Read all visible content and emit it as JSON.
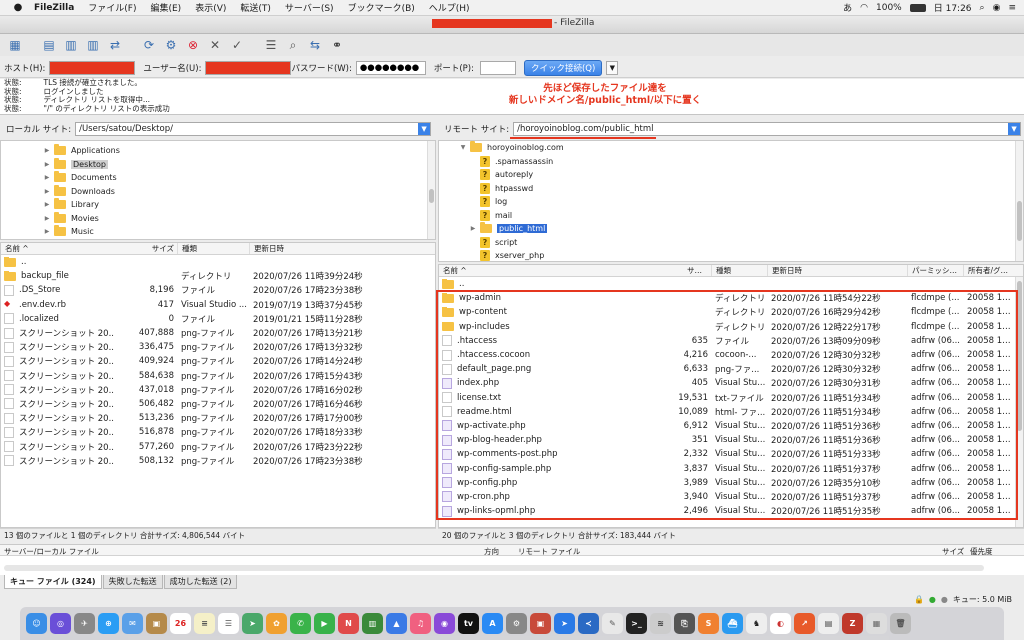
{
  "menubar": {
    "app": "FileZilla",
    "items": [
      "ファイル(F)",
      "編集(E)",
      "表示(V)",
      "転送(T)",
      "サーバー(S)",
      "ブックマーク(B)",
      "ヘルプ(H)"
    ],
    "ime": "あ",
    "battery": "100%",
    "clock": "日 17:26"
  },
  "window": {
    "title": "- FileZilla"
  },
  "quickconnect": {
    "host_label": "ホスト(H):",
    "user_label": "ユーザー名(U):",
    "pass_label": "パスワード(W):",
    "pass_value": "●●●●●●●●",
    "port_label": "ポート(P):",
    "button": "クイック接続(Q)"
  },
  "log": [
    {
      "k": "状態:",
      "v": "TLS 接続が確立されました。"
    },
    {
      "k": "状態:",
      "v": "ログインしました"
    },
    {
      "k": "状態:",
      "v": "ディレクトリ リストを取得中..."
    },
    {
      "k": "状態:",
      "v": "\"/\" のディレクトリ リストの表示成功"
    }
  ],
  "annotation": {
    "line1": "先ほど保存したファイル達を",
    "line2": "新しいドメイン名/public_html/以下に置く"
  },
  "local": {
    "label": "ローカル サイト:",
    "path": "/Users/satou/Desktop/",
    "tree": [
      {
        "name": "Applications",
        "sel": false
      },
      {
        "name": "Desktop",
        "sel": true
      },
      {
        "name": "Documents",
        "sel": false
      },
      {
        "name": "Downloads",
        "sel": false
      },
      {
        "name": "Library",
        "sel": false
      },
      {
        "name": "Movies",
        "sel": false
      },
      {
        "name": "Music",
        "sel": false
      }
    ],
    "headers": {
      "name": "名前",
      "size": "サイズ",
      "type": "種類",
      "date": "更新日時"
    },
    "files": [
      {
        "name": "..",
        "size": "",
        "type": "",
        "date": "",
        "icon": "folder"
      },
      {
        "name": "backup_file",
        "size": "",
        "type": "ディレクトリ",
        "date": "2020/07/26 11時39分24秒",
        "icon": "folder"
      },
      {
        "name": ".DS_Store",
        "size": "8,196",
        "type": "ファイル",
        "date": "2020/07/26 17時23分38秒",
        "icon": "file"
      },
      {
        "name": ".env.dev.rb",
        "size": "417",
        "type": "Visual Studio ...",
        "date": "2019/07/19 13時37分45秒",
        "icon": "rb"
      },
      {
        "name": ".localized",
        "size": "0",
        "type": "ファイル",
        "date": "2019/01/21 15時11分28秒",
        "icon": "file"
      },
      {
        "name": "スクリーンショット 20..",
        "size": "407,888",
        "type": "png-ファイル",
        "date": "2020/07/26 17時13分21秒",
        "icon": "file"
      },
      {
        "name": "スクリーンショット 20..",
        "size": "336,475",
        "type": "png-ファイル",
        "date": "2020/07/26 17時13分32秒",
        "icon": "file"
      },
      {
        "name": "スクリーンショット 20..",
        "size": "409,924",
        "type": "png-ファイル",
        "date": "2020/07/26 17時14分24秒",
        "icon": "file"
      },
      {
        "name": "スクリーンショット 20..",
        "size": "584,638",
        "type": "png-ファイル",
        "date": "2020/07/26 17時15分43秒",
        "icon": "file"
      },
      {
        "name": "スクリーンショット 20..",
        "size": "437,018",
        "type": "png-ファイル",
        "date": "2020/07/26 17時16分02秒",
        "icon": "file"
      },
      {
        "name": "スクリーンショット 20..",
        "size": "506,482",
        "type": "png-ファイル",
        "date": "2020/07/26 17時16分46秒",
        "icon": "file"
      },
      {
        "name": "スクリーンショット 20..",
        "size": "513,236",
        "type": "png-ファイル",
        "date": "2020/07/26 17時17分00秒",
        "icon": "file"
      },
      {
        "name": "スクリーンショット 20..",
        "size": "516,878",
        "type": "png-ファイル",
        "date": "2020/07/26 17時18分33秒",
        "icon": "file"
      },
      {
        "name": "スクリーンショット 20..",
        "size": "577,260",
        "type": "png-ファイル",
        "date": "2020/07/26 17時23分22秒",
        "icon": "file"
      },
      {
        "name": "スクリーンショット 20..",
        "size": "508,132",
        "type": "png-ファイル",
        "date": "2020/07/26 17時23分38秒",
        "icon": "file"
      }
    ],
    "status": "13 個のファイルと 1 個のディレクトリ 合計サイズ: 4,806,544 バイト"
  },
  "remote": {
    "label": "リモート サイト:",
    "path": "/horoyoinoblog.com/public_html",
    "tree_root": "horoyoinoblog.com",
    "tree": [
      {
        "name": ".spamassassin",
        "sel": false
      },
      {
        "name": "autoreply",
        "sel": false
      },
      {
        "name": "htpasswd",
        "sel": false
      },
      {
        "name": "log",
        "sel": false
      },
      {
        "name": "mail",
        "sel": false
      },
      {
        "name": "public_html",
        "sel": true
      },
      {
        "name": "script",
        "sel": false
      },
      {
        "name": "xserver_php",
        "sel": false
      }
    ],
    "headers": {
      "name": "名前",
      "size": "サイズ",
      "type": "種類",
      "date": "更新日時",
      "perm": "パーミッション",
      "owner": "所有者/グル..."
    },
    "files": [
      {
        "name": "..",
        "size": "",
        "type": "",
        "date": "",
        "perm": "",
        "owner": "",
        "icon": "folder"
      },
      {
        "name": "wp-admin",
        "size": "",
        "type": "ディレクトリ",
        "date": "2020/07/26 11時54分22秒",
        "perm": "flcdmpe (...",
        "owner": "20058 10...",
        "icon": "folder"
      },
      {
        "name": "wp-content",
        "size": "",
        "type": "ディレクトリ",
        "date": "2020/07/26 16時29分42秒",
        "perm": "flcdmpe (...",
        "owner": "20058 10...",
        "icon": "folder"
      },
      {
        "name": "wp-includes",
        "size": "",
        "type": "ディレクトリ",
        "date": "2020/07/26 12時22分17秒",
        "perm": "flcdmpe (...",
        "owner": "20058 10...",
        "icon": "folder"
      },
      {
        "name": ".htaccess",
        "size": "635",
        "type": "ファイル",
        "date": "2020/07/26 13時09分09秒",
        "perm": "adfrw (06...",
        "owner": "20058 10...",
        "icon": "file"
      },
      {
        "name": ".htaccess.cocoon",
        "size": "4,216",
        "type": "cocoon-...",
        "date": "2020/07/26 12時30分32秒",
        "perm": "adfrw (06...",
        "owner": "20058 10...",
        "icon": "file"
      },
      {
        "name": "default_page.png",
        "size": "6,633",
        "type": "png-ファ...",
        "date": "2020/07/26 12時30分32秒",
        "perm": "adfrw (06...",
        "owner": "20058 10...",
        "icon": "file"
      },
      {
        "name": "index.php",
        "size": "405",
        "type": "Visual Stu...",
        "date": "2020/07/26 12時30分31秒",
        "perm": "adfrw (06...",
        "owner": "20058 10...",
        "icon": "code"
      },
      {
        "name": "license.txt",
        "size": "19,531",
        "type": "txt-ファイル",
        "date": "2020/07/26 11時51分34秒",
        "perm": "adfrw (06...",
        "owner": "20058 10...",
        "icon": "file"
      },
      {
        "name": "readme.html",
        "size": "10,089",
        "type": "html- ファ...",
        "date": "2020/07/26 11時51分34秒",
        "perm": "adfrw (06...",
        "owner": "20058 10...",
        "icon": "file"
      },
      {
        "name": "wp-activate.php",
        "size": "6,912",
        "type": "Visual Stu...",
        "date": "2020/07/26 11時51分36秒",
        "perm": "adfrw (06...",
        "owner": "20058 10...",
        "icon": "code"
      },
      {
        "name": "wp-blog-header.php",
        "size": "351",
        "type": "Visual Stu...",
        "date": "2020/07/26 11時51分36秒",
        "perm": "adfrw (06...",
        "owner": "20058 10...",
        "icon": "code"
      },
      {
        "name": "wp-comments-post.php",
        "size": "2,332",
        "type": "Visual Stu...",
        "date": "2020/07/26 11時51分33秒",
        "perm": "adfrw (06...",
        "owner": "20058 10...",
        "icon": "code"
      },
      {
        "name": "wp-config-sample.php",
        "size": "3,837",
        "type": "Visual Stu...",
        "date": "2020/07/26 11時51分37秒",
        "perm": "adfrw (06...",
        "owner": "20058 10...",
        "icon": "code"
      },
      {
        "name": "wp-config.php",
        "size": "3,989",
        "type": "Visual Stu...",
        "date": "2020/07/26 12時35分10秒",
        "perm": "adfrw (06...",
        "owner": "20058 10...",
        "icon": "code"
      },
      {
        "name": "wp-cron.php",
        "size": "3,940",
        "type": "Visual Stu...",
        "date": "2020/07/26 11時51分37秒",
        "perm": "adfrw (06...",
        "owner": "20058 10...",
        "icon": "code"
      },
      {
        "name": "wp-links-opml.php",
        "size": "2,496",
        "type": "Visual Stu...",
        "date": "2020/07/26 11時51分35秒",
        "perm": "adfrw (06...",
        "owner": "20058 10...",
        "icon": "code"
      }
    ],
    "status": "20 個のファイルと 3 個のディレクトリ 合計サイズ: 183,444 バイト"
  },
  "queue": {
    "h_server": "サーバー/ローカル ファイル",
    "h_dir": "方向",
    "h_remote": "リモート ファイル",
    "h_size": "サイズ",
    "h_prio": "優先度",
    "tabs": [
      "キュー ファイル (324)",
      "失敗した転送",
      "成功した転送 (2)"
    ],
    "status": "キュー: 5.0 MiB"
  },
  "colors": {
    "annotation": "#e5361f",
    "selection": "#2f6bd5"
  }
}
